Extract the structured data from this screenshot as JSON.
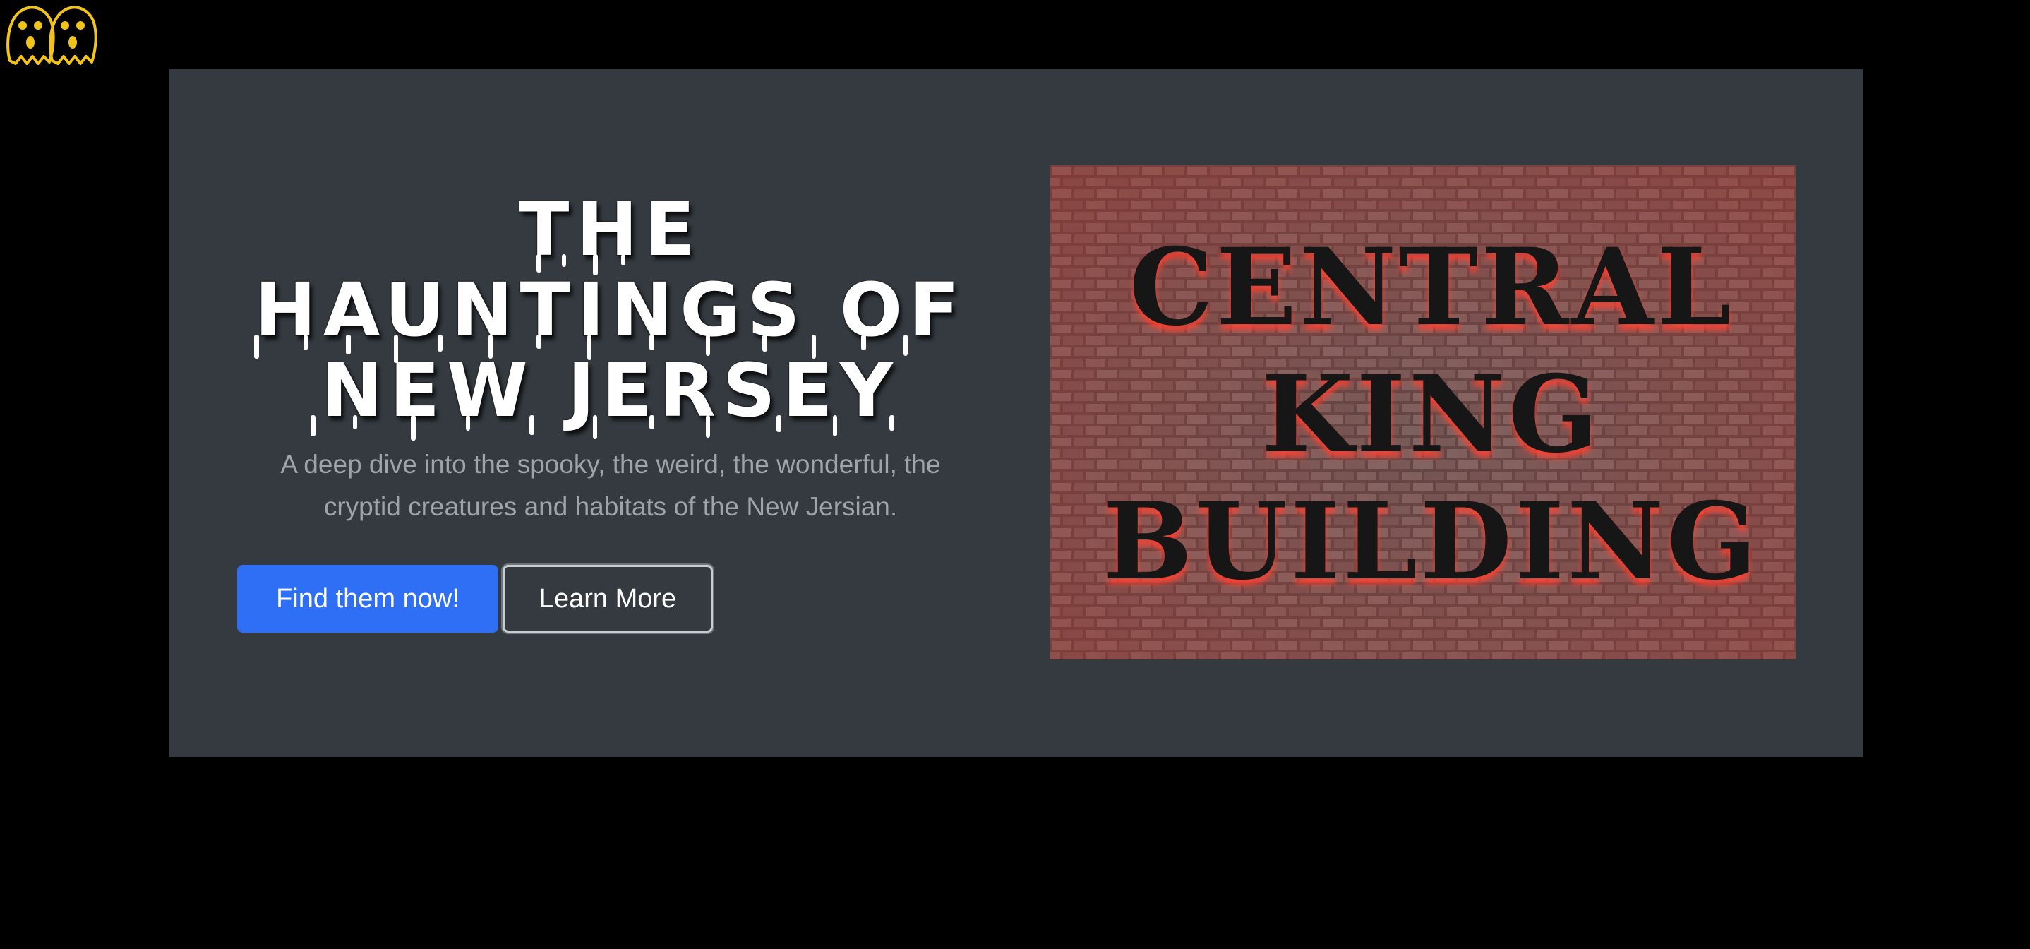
{
  "logo": {
    "icon": "twin-ghosts-icon",
    "color": "#f2c318"
  },
  "hero": {
    "title_lines": [
      "THE",
      "HAUNTINGS OF",
      "NEW JERSEY"
    ],
    "subtitle": "A deep dive into the spooky, the weird, the wonderful, the cryptid creatures and habitats of the New Jersian.",
    "primary_button": "Find them now!",
    "secondary_button": "Learn More",
    "image": {
      "sign_lines": [
        "CENTRAL",
        "KING",
        "BUILDING"
      ]
    }
  },
  "colors": {
    "page_bg": "#000000",
    "hero_bg": "#343a40",
    "primary": "#2f6ff5",
    "subtitle": "#9ea4aa",
    "brick_glow": "#e0403a"
  }
}
